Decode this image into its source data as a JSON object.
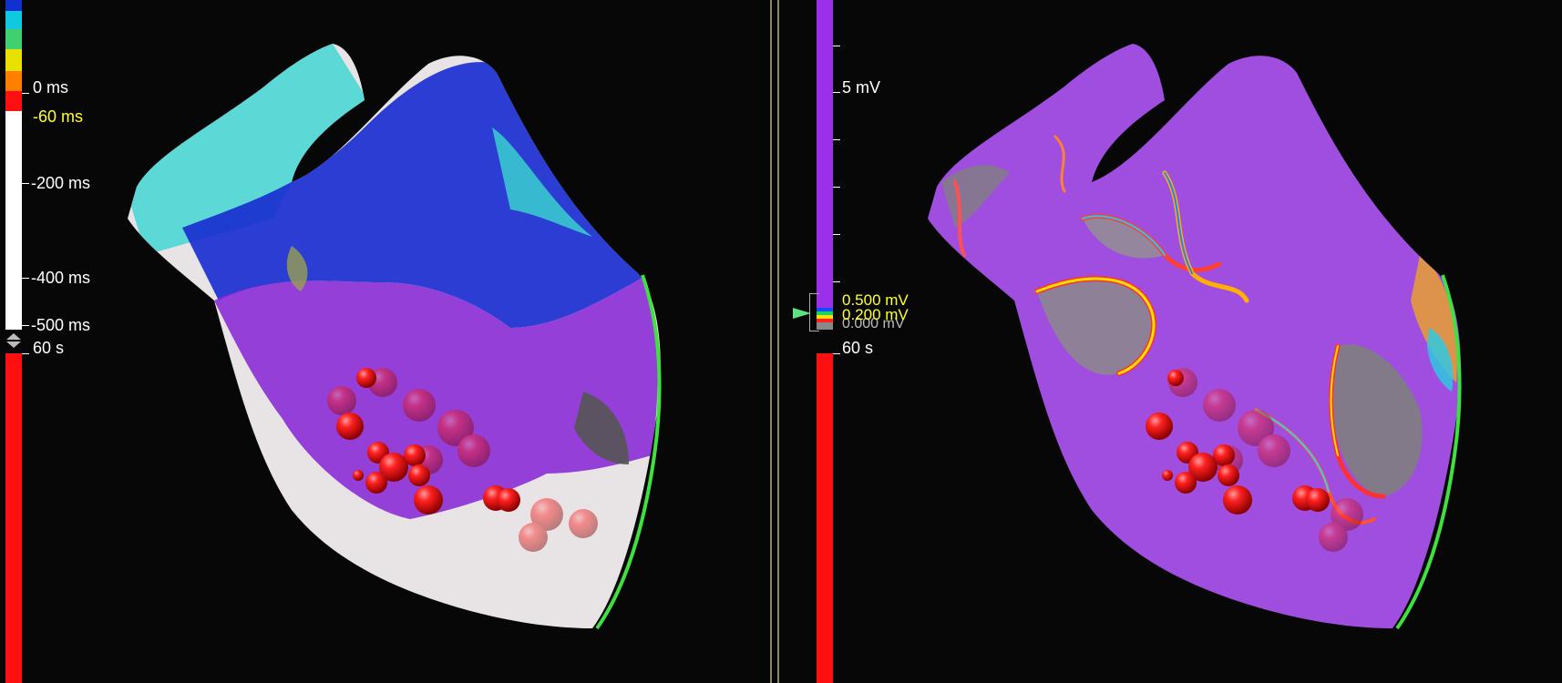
{
  "left_view": {
    "legend": {
      "labels": [
        "0 ms",
        "-60 ms",
        "-200 ms",
        "-400 ms",
        "-500 ms"
      ],
      "highlight_label": "-60 ms",
      "colors": [
        "#1030d0",
        "#10c8e0",
        "#40d070",
        "#e8e000",
        "#ff8000",
        "#ff1010",
        "#ffffff"
      ]
    },
    "timer_label": "60 s",
    "timer_color": "#ff1010"
  },
  "right_view": {
    "legend": {
      "labels": [
        "5 mV",
        "0.500 mV",
        "0.200 mV",
        "0.000 mV"
      ],
      "bar_color": "#9b30e8"
    },
    "timer_label": "60 s",
    "timer_color": "#ff1010"
  },
  "colors": {
    "background": "#070707",
    "border_highlight": "#40e040",
    "ablation_point": "#ff1a1a"
  }
}
